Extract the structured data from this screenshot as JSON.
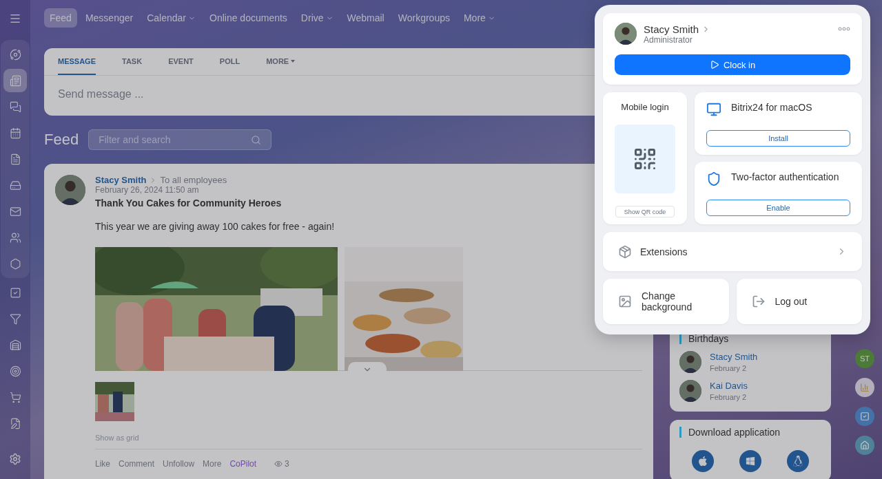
{
  "sidebar": {
    "items": [
      {
        "selected": false
      },
      {
        "selected": true
      },
      {
        "selected": false
      },
      {
        "selected": false
      },
      {
        "selected": false
      },
      {
        "selected": false
      },
      {
        "selected": false
      },
      {
        "selected": false
      },
      {
        "selected": false
      },
      {
        "selected": false
      },
      {
        "selected": false
      },
      {
        "selected": false
      },
      {
        "selected": false
      },
      {
        "selected": false
      },
      {
        "selected": false
      }
    ]
  },
  "top_nav": [
    {
      "label": "Feed",
      "selected": true,
      "dropdown": false
    },
    {
      "label": "Messenger",
      "selected": false,
      "dropdown": false
    },
    {
      "label": "Calendar",
      "selected": false,
      "dropdown": true
    },
    {
      "label": "Online documents",
      "selected": false,
      "dropdown": false
    },
    {
      "label": "Drive",
      "selected": false,
      "dropdown": true
    },
    {
      "label": "Webmail",
      "selected": false,
      "dropdown": false
    },
    {
      "label": "Workgroups",
      "selected": false,
      "dropdown": false
    },
    {
      "label": "More",
      "selected": false,
      "dropdown": true
    }
  ],
  "composer": {
    "tabs": [
      {
        "label": "MESSAGE",
        "selected": true,
        "dropdown": false
      },
      {
        "label": "TASK",
        "selected": false,
        "dropdown": false
      },
      {
        "label": "EVENT",
        "selected": false,
        "dropdown": false
      },
      {
        "label": "POLL",
        "selected": false,
        "dropdown": false
      },
      {
        "label": "MORE",
        "selected": false,
        "dropdown": true
      }
    ],
    "placeholder": "Send message ..."
  },
  "feed": {
    "title": "Feed",
    "search_placeholder": "Filter and search"
  },
  "post": {
    "author": "Stacy Smith",
    "recipient": "To all employees",
    "date": "February 26, 2024 11:50 am",
    "title": "Thank You Cakes for Community Heroes",
    "body": "This year we are giving away 100 cakes for free - again!",
    "show_as_grid": "Show as grid",
    "actions": [
      {
        "label": "Like",
        "kind": "plain"
      },
      {
        "label": "Comment",
        "kind": "plain"
      },
      {
        "label": "Unfollow",
        "kind": "plain"
      },
      {
        "label": "More",
        "kind": "plain"
      },
      {
        "label": "CoPilot",
        "kind": "copilot"
      }
    ],
    "views": "3"
  },
  "birthdays": {
    "title": "Birthdays",
    "people": [
      {
        "name": "Stacy Smith",
        "date": "February 2"
      },
      {
        "name": "Kai Davis",
        "date": "February 2"
      }
    ]
  },
  "download": {
    "title": "Download application"
  },
  "right_strip": {
    "avatar_initials": "ST"
  },
  "profile_popup": {
    "name": "Stacy Smith",
    "role": "Administrator",
    "clock_in": "Clock in",
    "mobile_login": {
      "title": "Mobile login",
      "button": "Show QR code"
    },
    "apps": [
      {
        "kind": "desktop",
        "title": "Bitrix24 for macOS",
        "button": "Install"
      },
      {
        "kind": "security",
        "title": "Two-factor authentication",
        "button": "Enable"
      }
    ],
    "extensions": "Extensions",
    "change_background": "Change background",
    "log_out": "Log out"
  }
}
